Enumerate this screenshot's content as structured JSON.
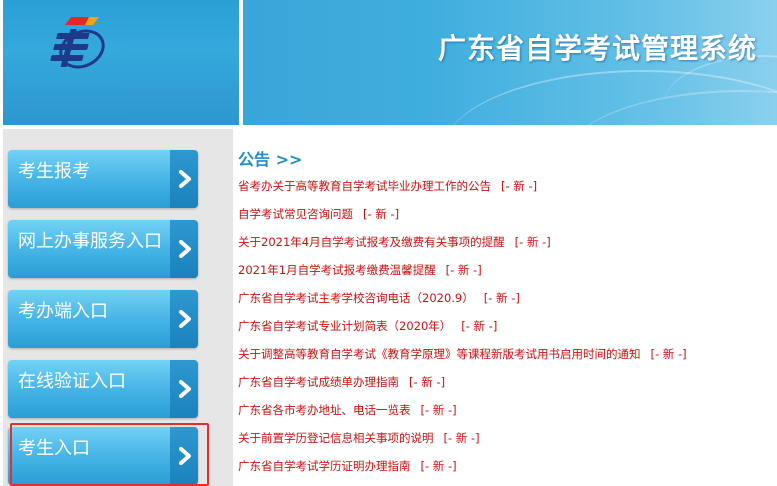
{
  "header": {
    "title": "广东省自学考试管理系统"
  },
  "sidebar": {
    "items": [
      {
        "label": "考生报考"
      },
      {
        "label": "网上办事服务入口"
      },
      {
        "label": "考办端入口"
      },
      {
        "label": "在线验证入口"
      },
      {
        "label": "考生入口"
      }
    ]
  },
  "notices": {
    "title": "公告 >>",
    "badge": "[- 新 -]",
    "items": [
      {
        "text": "省考办关于高等教育自学考试毕业办理工作的公告"
      },
      {
        "text": "自学考试常见咨询问题"
      },
      {
        "text": "关于2021年4月自学考试报考及缴费有关事项的提醒"
      },
      {
        "text": "2021年1月自学考试报考缴费温馨提醒"
      },
      {
        "text": "广东省自学考试主考学校咨询电话（2020.9）"
      },
      {
        "text": "广东省自学考试专业计划简表（2020年）"
      },
      {
        "text": "关于调整高等教育自学考试《教育学原理》等课程新版考试用书启用时间的通知"
      },
      {
        "text": "广东省自学考试成绩单办理指南"
      },
      {
        "text": "广东省各市考办地址、电话一览表"
      },
      {
        "text": "关于前置学历登记信息相关事项的说明"
      },
      {
        "text": "广东省自学考试学历证明办理指南"
      }
    ]
  },
  "colors": {
    "header_blue": "#38a6d8",
    "nav_button": "#47b5e6",
    "notice_title": "#1f8ec5",
    "notice_link": "#cc1111",
    "highlight": "#e23030"
  },
  "icons": {
    "logo": "exam-system-logo-icon",
    "nav_arrow": "chevron-right-icon"
  }
}
